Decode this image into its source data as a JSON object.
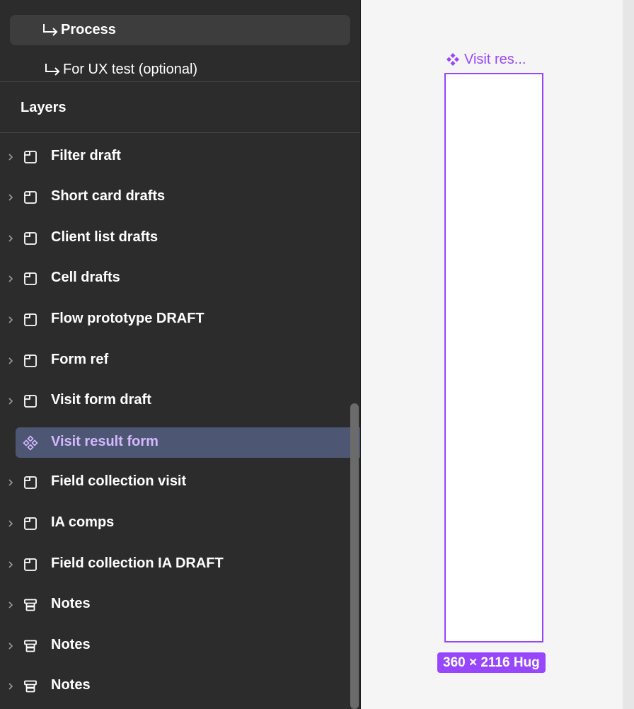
{
  "pages": [
    {
      "label": "Process",
      "selected": true
    },
    {
      "label": "For UX test (optional)",
      "selected": false
    }
  ],
  "layers_panel": {
    "title": "Layers",
    "items": [
      {
        "name": "Filter draft",
        "icon": "frame-icon"
      },
      {
        "name": "Short card drafts",
        "icon": "frame-icon"
      },
      {
        "name": "Client list drafts",
        "icon": "frame-icon"
      },
      {
        "name": "Cell drafts",
        "icon": "frame-icon"
      },
      {
        "name": "Flow prototype DRAFT",
        "icon": "frame-icon"
      },
      {
        "name": "Form ref",
        "icon": "frame-icon"
      },
      {
        "name": "Visit form draft",
        "icon": "frame-icon"
      },
      {
        "name": "Visit result form",
        "icon": "component-icon",
        "selected": true
      },
      {
        "name": "Field collection visit",
        "icon": "frame-icon"
      },
      {
        "name": "IA comps",
        "icon": "frame-icon"
      },
      {
        "name": "Field collection IA DRAFT",
        "icon": "frame-icon"
      },
      {
        "name": "Notes",
        "icon": "section-icon"
      },
      {
        "name": "Notes",
        "icon": "section-icon"
      },
      {
        "name": "Notes",
        "icon": "section-icon"
      }
    ]
  },
  "canvas": {
    "frame_label": "Visit res...",
    "dimensions": "360 × 2116 Hug",
    "accent_color": "#9747ff"
  }
}
